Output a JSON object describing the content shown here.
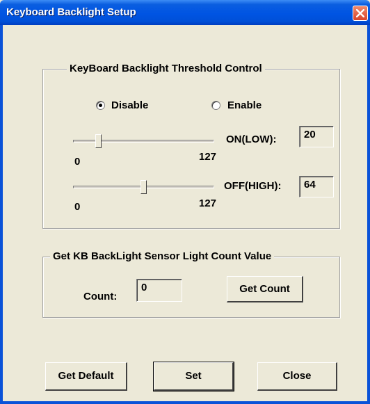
{
  "window": {
    "title": "Keyboard Backlight Setup"
  },
  "threshold": {
    "legend": "KeyBoard Backlight Threshold Control",
    "radio_disable": "Disable",
    "radio_enable": "Enable",
    "selected": "Disable",
    "on_low": {
      "label": "ON(LOW):",
      "value": "20",
      "min_label": "0",
      "max_label": "127"
    },
    "off_high": {
      "label": "OFF(HIGH):",
      "value": "64",
      "min_label": "0",
      "max_label": "127"
    }
  },
  "sensor": {
    "legend": "Get KB BackLight Sensor Light Count Value",
    "count_label": "Count:",
    "count_value": "0",
    "get_count_button": "Get Count"
  },
  "buttons": {
    "get_default": "Get Default",
    "set": "Set",
    "close": "Close"
  },
  "icons": {
    "close": "close-x-icon"
  }
}
